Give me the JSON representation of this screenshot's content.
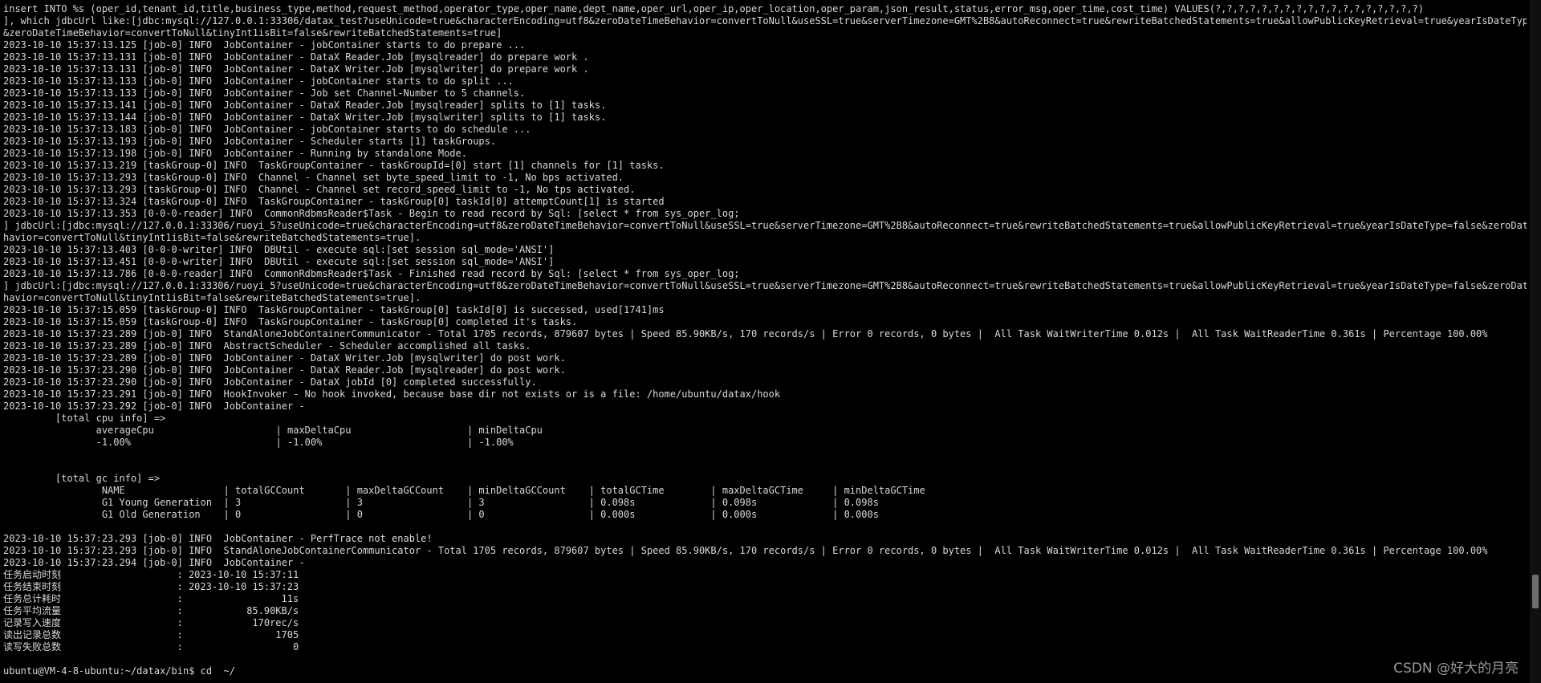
{
  "terminal": {
    "lines": [
      "insert INTO %s (oper_id,tenant_id,title,business_type,method,request_method,operator_type,oper_name,dept_name,oper_url,oper_ip,oper_location,oper_param,json_result,status,error_msg,oper_time,cost_time) VALUES(?,?,?,?,?,?,?,?,?,?,?,?,?,?,?,?,?,?)",
      "], which jdbcUrl like:[jdbc:mysql://127.0.0.1:33306/datax_test?useUnicode=true&characterEncoding=utf8&zeroDateTimeBehavior=convertToNull&useSSL=true&serverTimezone=GMT%2B8&autoReconnect=true&rewriteBatchedStatements=true&allowPublicKeyRetrieval=true&yearIsDateType=false",
      "&zeroDateTimeBehavior=convertToNull&tinyInt1isBit=false&rewriteBatchedStatements=true]",
      "2023-10-10 15:37:13.125 [job-0] INFO  JobContainer - jobContainer starts to do prepare ...",
      "2023-10-10 15:37:13.131 [job-0] INFO  JobContainer - DataX Reader.Job [mysqlreader] do prepare work .",
      "2023-10-10 15:37:13.131 [job-0] INFO  JobContainer - DataX Writer.Job [mysqlwriter] do prepare work .",
      "2023-10-10 15:37:13.133 [job-0] INFO  JobContainer - jobContainer starts to do split ...",
      "2023-10-10 15:37:13.133 [job-0] INFO  JobContainer - Job set Channel-Number to 5 channels.",
      "2023-10-10 15:37:13.141 [job-0] INFO  JobContainer - DataX Reader.Job [mysqlreader] splits to [1] tasks.",
      "2023-10-10 15:37:13.144 [job-0] INFO  JobContainer - DataX Writer.Job [mysqlwriter] splits to [1] tasks.",
      "2023-10-10 15:37:13.183 [job-0] INFO  JobContainer - jobContainer starts to do schedule ...",
      "2023-10-10 15:37:13.193 [job-0] INFO  JobContainer - Scheduler starts [1] taskGroups.",
      "2023-10-10 15:37:13.198 [job-0] INFO  JobContainer - Running by standalone Mode.",
      "2023-10-10 15:37:13.219 [taskGroup-0] INFO  TaskGroupContainer - taskGroupId=[0] start [1] channels for [1] tasks.",
      "2023-10-10 15:37:13.293 [taskGroup-0] INFO  Channel - Channel set byte_speed_limit to -1, No bps activated.",
      "2023-10-10 15:37:13.293 [taskGroup-0] INFO  Channel - Channel set record_speed_limit to -1, No tps activated.",
      "2023-10-10 15:37:13.324 [taskGroup-0] INFO  TaskGroupContainer - taskGroup[0] taskId[0] attemptCount[1] is started",
      "2023-10-10 15:37:13.353 [0-0-0-reader] INFO  CommonRdbmsReader$Task - Begin to read record by Sql: [select * from sys_oper_log;",
      "] jdbcUrl:[jdbc:mysql://127.0.0.1:33306/ruoyi_5?useUnicode=true&characterEncoding=utf8&zeroDateTimeBehavior=convertToNull&useSSL=true&serverTimezone=GMT%2B8&autoReconnect=true&rewriteBatchedStatements=true&allowPublicKeyRetrieval=true&yearIsDateType=false&zeroDateTimeBe",
      "havior=convertToNull&tinyInt1isBit=false&rewriteBatchedStatements=true].",
      "2023-10-10 15:37:13.403 [0-0-0-writer] INFO  DBUtil - execute sql:[set session sql_mode='ANSI']",
      "2023-10-10 15:37:13.451 [0-0-0-writer] INFO  DBUtil - execute sql:[set session sql_mode='ANSI']",
      "2023-10-10 15:37:13.786 [0-0-0-reader] INFO  CommonRdbmsReader$Task - Finished read record by Sql: [select * from sys_oper_log;",
      "] jdbcUrl:[jdbc:mysql://127.0.0.1:33306/ruoyi_5?useUnicode=true&characterEncoding=utf8&zeroDateTimeBehavior=convertToNull&useSSL=true&serverTimezone=GMT%2B8&autoReconnect=true&rewriteBatchedStatements=true&allowPublicKeyRetrieval=true&yearIsDateType=false&zeroDateTimeBe",
      "havior=convertToNull&tinyInt1isBit=false&rewriteBatchedStatements=true].",
      "2023-10-10 15:37:15.059 [taskGroup-0] INFO  TaskGroupContainer - taskGroup[0] taskId[0] is successed, used[1741]ms",
      "2023-10-10 15:37:15.059 [taskGroup-0] INFO  TaskGroupContainer - taskGroup[0] completed it's tasks.",
      "2023-10-10 15:37:23.289 [job-0] INFO  StandAloneJobContainerCommunicator - Total 1705 records, 879607 bytes | Speed 85.90KB/s, 170 records/s | Error 0 records, 0 bytes |  All Task WaitWriterTime 0.012s |  All Task WaitReaderTime 0.361s | Percentage 100.00%",
      "2023-10-10 15:37:23.289 [job-0] INFO  AbstractScheduler - Scheduler accomplished all tasks.",
      "2023-10-10 15:37:23.289 [job-0] INFO  JobContainer - DataX Writer.Job [mysqlwriter] do post work.",
      "2023-10-10 15:37:23.290 [job-0] INFO  JobContainer - DataX Reader.Job [mysqlreader] do post work.",
      "2023-10-10 15:37:23.290 [job-0] INFO  JobContainer - DataX jobId [0] completed successfully.",
      "2023-10-10 15:37:23.291 [job-0] INFO  HookInvoker - No hook invoked, because base dir not exists or is a file: /home/ubuntu/datax/hook",
      "2023-10-10 15:37:23.292 [job-0] INFO  JobContainer -",
      "         [total cpu info] =>",
      "                averageCpu                     | maxDeltaCpu                    | minDeltaCpu",
      "                -1.00%                         | -1.00%                         | -1.00%",
      "",
      "",
      "         [total gc info] =>",
      "                 NAME                 | totalGCCount       | maxDeltaGCCount    | minDeltaGCCount    | totalGCTime        | maxDeltaGCTime     | minDeltaGCTime",
      "                 G1 Young Generation  | 3                  | 3                  | 3                  | 0.098s             | 0.098s             | 0.098s",
      "                 G1 Old Generation    | 0                  | 0                  | 0                  | 0.000s             | 0.000s             | 0.000s",
      "",
      "2023-10-10 15:37:23.293 [job-0] INFO  JobContainer - PerfTrace not enable!",
      "2023-10-10 15:37:23.293 [job-0] INFO  StandAloneJobContainerCommunicator - Total 1705 records, 879607 bytes | Speed 85.90KB/s, 170 records/s | Error 0 records, 0 bytes |  All Task WaitWriterTime 0.012s |  All Task WaitReaderTime 0.361s | Percentage 100.00%",
      "2023-10-10 15:37:23.294 [job-0] INFO  JobContainer -",
      "任务启动时刻                    : 2023-10-10 15:37:11",
      "任务结束时刻                    : 2023-10-10 15:37:23",
      "任务总计耗时                    :                 11s",
      "任务平均流量                    :           85.90KB/s",
      "记录写入速度                    :            170rec/s",
      "读出记录总数                    :                1705",
      "读写失败总数                    :                   0",
      "",
      "ubuntu@VM-4-8-ubuntu:~/datax/bin$ cd  ~/"
    ]
  },
  "watermark": "CSDN @好大的月亮"
}
